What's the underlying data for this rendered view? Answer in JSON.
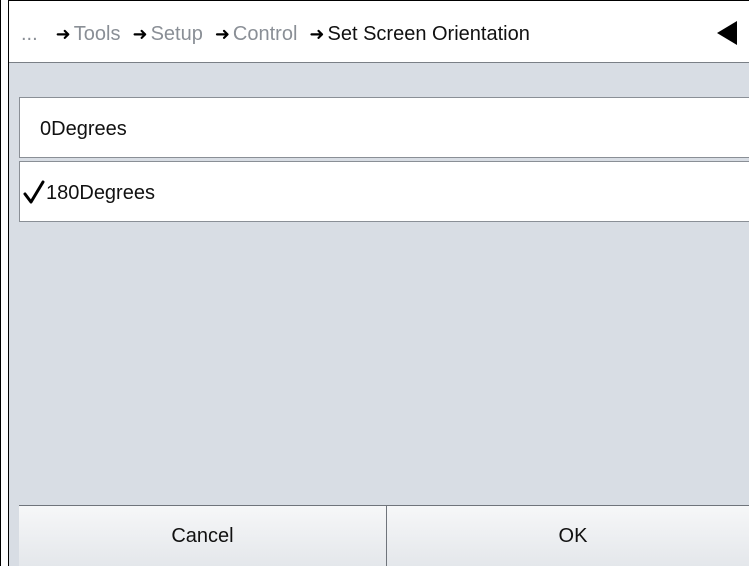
{
  "header": {
    "ellipsis": "...",
    "breadcrumb": [
      {
        "label": "Tools"
      },
      {
        "label": "Setup"
      },
      {
        "label": "Control"
      },
      {
        "label": "Set Screen Orientation"
      }
    ],
    "back_icon": "triangle-left-icon"
  },
  "options": [
    {
      "label": "0Degrees",
      "selected": false
    },
    {
      "label": "180Degrees",
      "selected": true
    }
  ],
  "footer": {
    "cancel_label": "Cancel",
    "ok_label": "OK"
  }
}
